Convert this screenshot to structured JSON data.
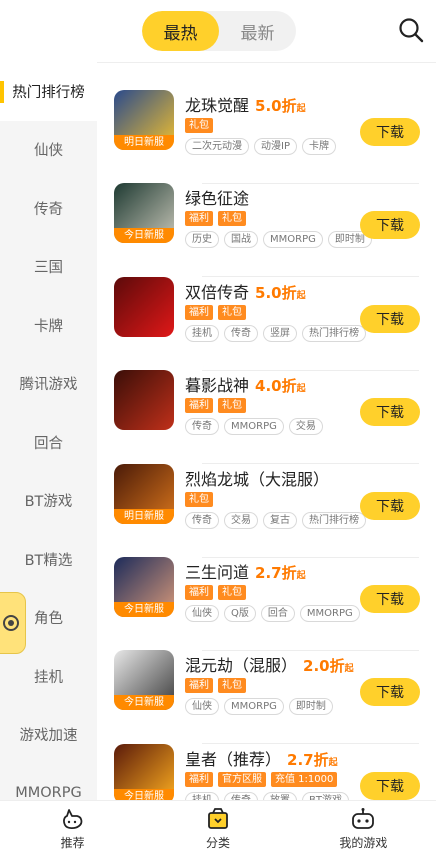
{
  "tabs": [
    {
      "label": "最热",
      "active": true
    },
    {
      "label": "最新",
      "active": false
    }
  ],
  "sidebar": [
    "热门排行榜",
    "仙侠",
    "传奇",
    "三国",
    "卡牌",
    "腾讯游戏",
    "回合",
    "BT游戏",
    "BT精选",
    "角色",
    "挂机",
    "游戏加速",
    "MMORPG"
  ],
  "games": [
    {
      "name": "龙珠觉醒",
      "discount": "5.0折",
      "disc_suffix": "起",
      "ribbon": "明日新服",
      "badges": [
        "礼包"
      ],
      "tags": [
        "二次元动漫",
        "动漫IP",
        "卡牌"
      ],
      "btn": "下载",
      "colors": [
        "#2a4a8c",
        "#f2c12e"
      ]
    },
    {
      "name": "绿色征途",
      "discount": "",
      "disc_suffix": "",
      "ribbon": "今日新服",
      "badges": [
        "福利",
        "礼包"
      ],
      "tags": [
        "历史",
        "国战",
        "MMORPG",
        "即时制"
      ],
      "btn": "下载",
      "colors": [
        "#1e3a32",
        "#c8c6b8"
      ]
    },
    {
      "name": "双倍传奇",
      "discount": "5.0折",
      "disc_suffix": "起",
      "ribbon": "",
      "badges": [
        "福利",
        "礼包"
      ],
      "tags": [
        "挂机",
        "传奇",
        "竖屏",
        "热门排行榜"
      ],
      "btn": "下载",
      "colors": [
        "#5c0a0a",
        "#e01818"
      ]
    },
    {
      "name": "暮影战神",
      "discount": "4.0折",
      "disc_suffix": "起",
      "ribbon": "",
      "badges": [
        "福利",
        "礼包"
      ],
      "tags": [
        "传奇",
        "MMORPG",
        "交易"
      ],
      "btn": "下载",
      "colors": [
        "#3a0e08",
        "#c0301a"
      ]
    },
    {
      "name": "烈焰龙城（大混服）",
      "discount": "",
      "disc_suffix": "",
      "ribbon": "明日新服",
      "badges": [
        "礼包"
      ],
      "tags": [
        "传奇",
        "交易",
        "复古",
        "热门排行榜"
      ],
      "btn": "下载",
      "colors": [
        "#4a1a08",
        "#d8751c"
      ]
    },
    {
      "name": "三生问道",
      "discount": "2.7折",
      "disc_suffix": "起",
      "ribbon": "今日新服",
      "badges": [
        "福利",
        "礼包"
      ],
      "tags": [
        "仙侠",
        "Q版",
        "回合",
        "MMORPG"
      ],
      "btn": "下载",
      "colors": [
        "#1c2b5a",
        "#d99a7a"
      ]
    },
    {
      "name": "混元劫（混服）",
      "discount": "2.0折",
      "disc_suffix": "起",
      "ribbon": "今日新服",
      "badges": [
        "福利",
        "礼包"
      ],
      "tags": [
        "仙侠",
        "MMORPG",
        "即时制"
      ],
      "btn": "下载",
      "colors": [
        "#e8e8e8",
        "#3a3a3a"
      ]
    },
    {
      "name": "皇者（推荐）",
      "discount": "2.7折",
      "disc_suffix": "起",
      "ribbon": "今日新服",
      "badges": [
        "福利",
        "官方区服",
        "充值 1:1000"
      ],
      "tags": [
        "挂机",
        "传奇",
        "放置",
        "BT游戏"
      ],
      "btn": "下载",
      "colors": [
        "#5a1a0a",
        "#ffb020"
      ]
    }
  ],
  "bottom_nav": [
    {
      "label": "推荐",
      "icon": "recommend-icon"
    },
    {
      "label": "分类",
      "icon": "category-icon"
    },
    {
      "label": "我的游戏",
      "icon": "my-games-icon"
    }
  ],
  "accent_color": "#ffd02b",
  "discount_color": "#ff7a00"
}
